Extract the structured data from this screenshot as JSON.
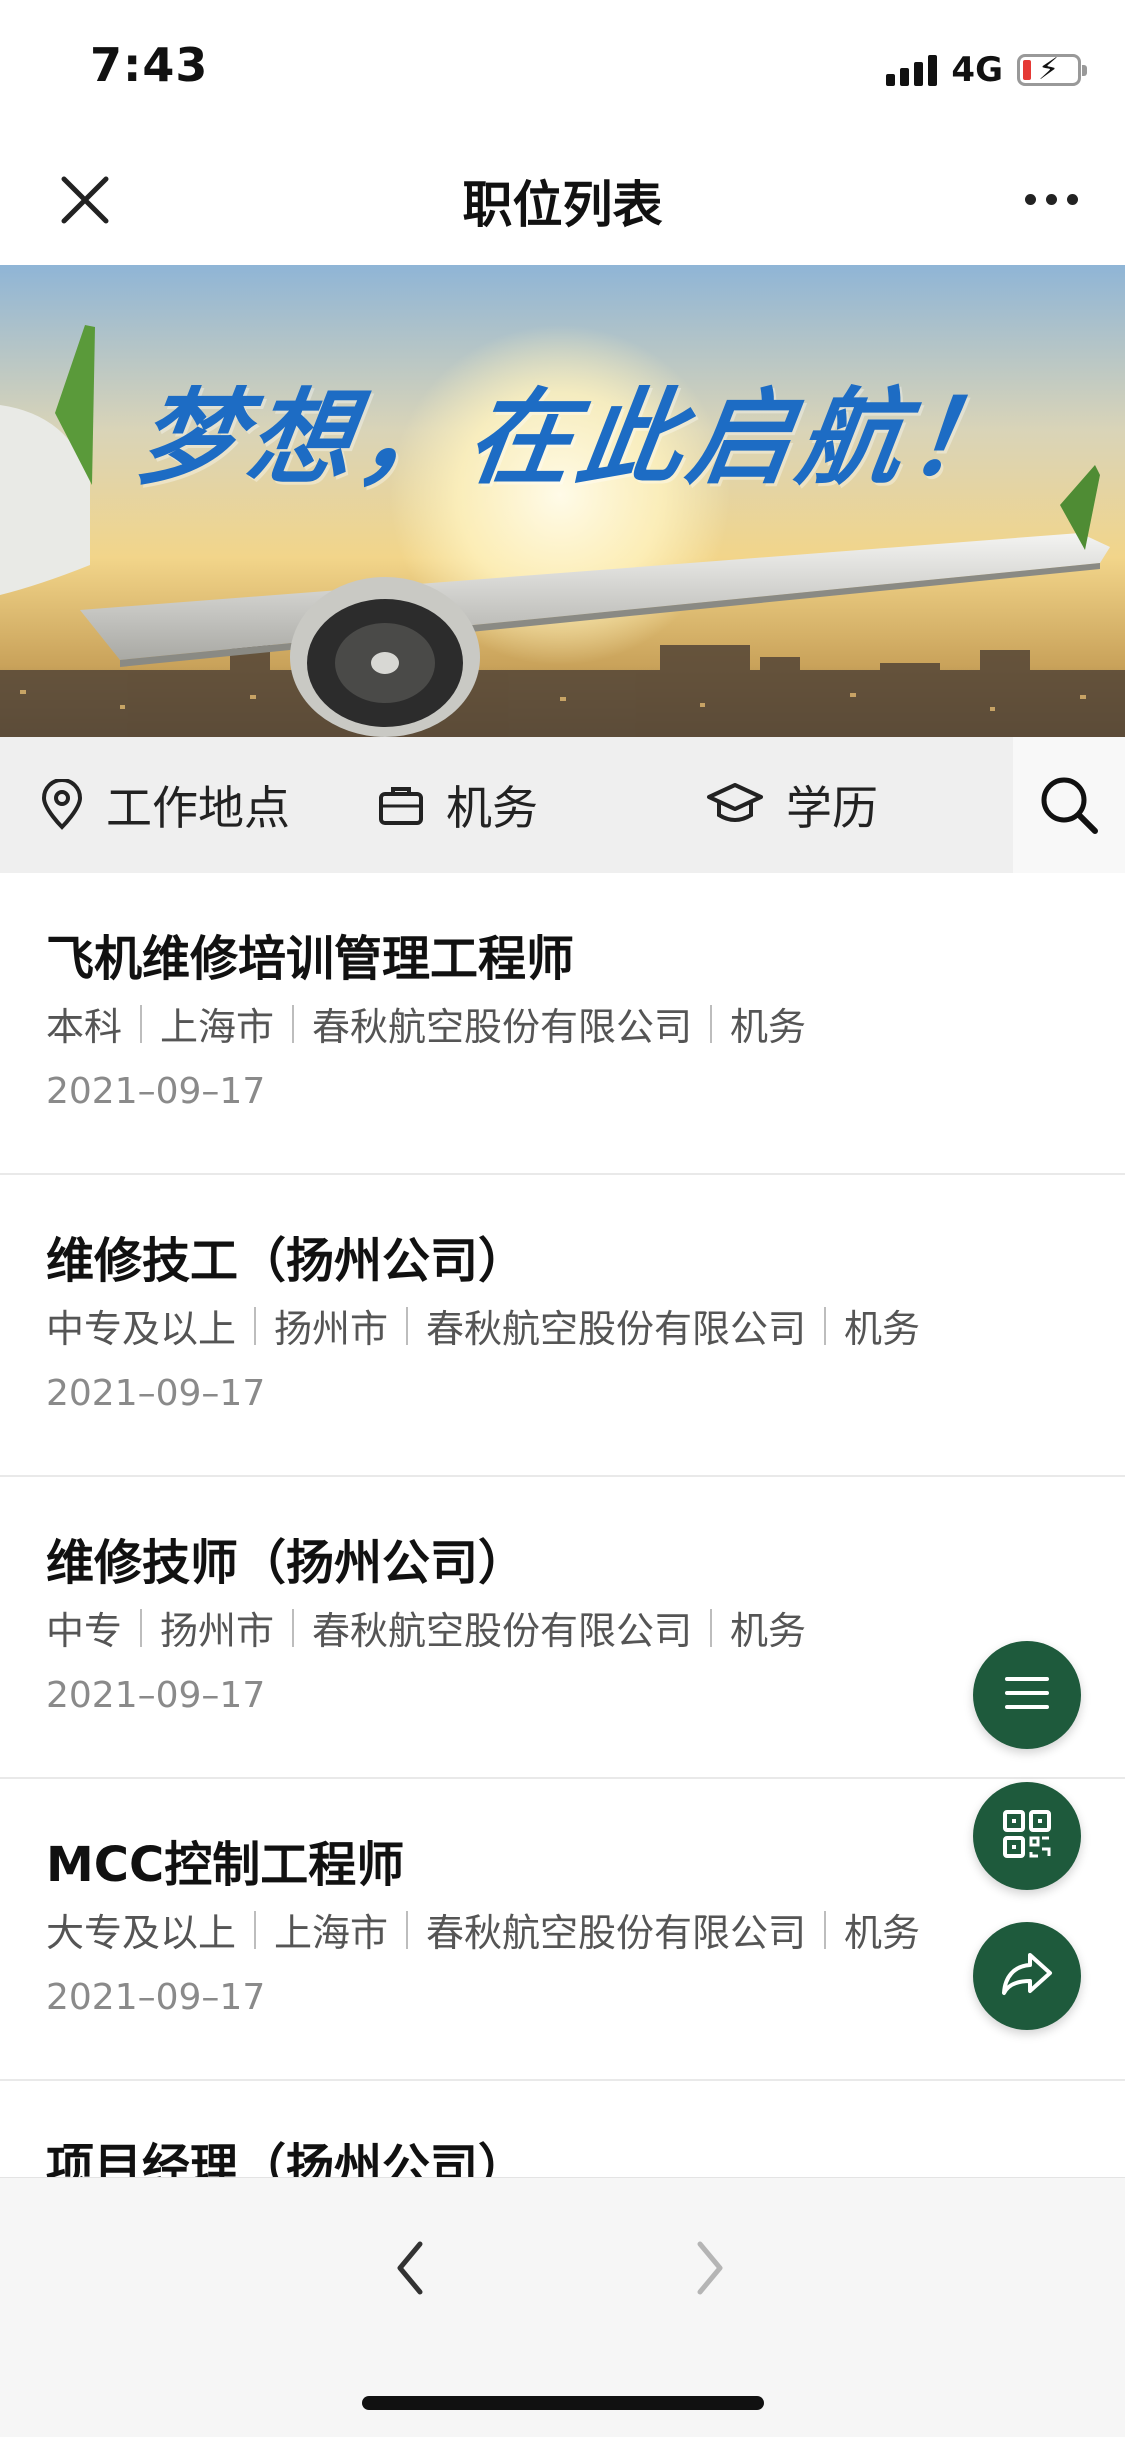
{
  "status_bar": {
    "time": "7:43",
    "network": "4G"
  },
  "nav": {
    "title": "职位列表"
  },
  "banner": {
    "slogan": "梦想，在此启航！"
  },
  "filters": {
    "location": "工作地点",
    "category": "机务",
    "education": "学历"
  },
  "jobs": [
    {
      "title": "飞机维修培训管理工程师",
      "education": "本科",
      "city": "上海市",
      "company": "春秋航空股份有限公司",
      "category": "机务",
      "date": "2021–09–17"
    },
    {
      "title": "维修技工（扬州公司）",
      "education": "中专及以上",
      "city": "扬州市",
      "company": "春秋航空股份有限公司",
      "category": "机务",
      "date": "2021–09–17"
    },
    {
      "title": "维修技师（扬州公司）",
      "education": "中专",
      "city": "扬州市",
      "company": "春秋航空股份有限公司",
      "category": "机务",
      "date": "2021–09–17"
    },
    {
      "title": "MCC控制工程师",
      "education": "大专及以上",
      "city": "上海市",
      "company": "春秋航空股份有限公司",
      "category": "机务",
      "date": "2021–09–17"
    },
    {
      "title": "项目经理（扬州公司）"
    }
  ],
  "fabs": [
    "menu-icon",
    "qr-code-icon",
    "share-icon"
  ],
  "colors": {
    "fab": "#1e5a3c",
    "slogan": "#1d6cc4",
    "filter_bg": "#efefef"
  }
}
